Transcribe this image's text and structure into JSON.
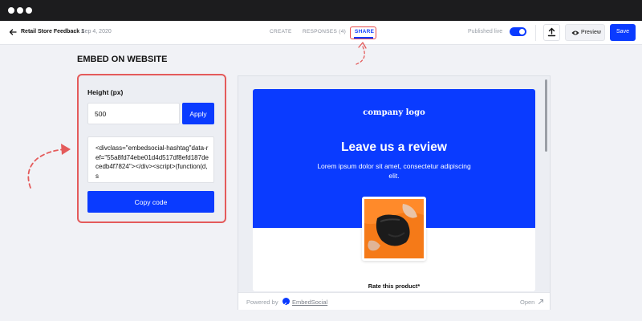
{
  "window": {
    "controls": [
      "dot",
      "dot",
      "dot"
    ]
  },
  "header": {
    "title": "Retail Store Feedback 1",
    "date": "Sep 4, 2020",
    "tabs": [
      {
        "label": "CREATE",
        "active": false
      },
      {
        "label": "RESPONSES (4)",
        "active": false
      },
      {
        "label": "SHARE",
        "active": true
      }
    ],
    "published_label": "Published live",
    "published": true,
    "preview_label": "Preview",
    "save_label": "Save"
  },
  "embed": {
    "heading": "EMBED ON WEBSITE",
    "height_label": "Height (px)",
    "height_value": "500",
    "apply_label": "Apply",
    "code": "<divclass=\"embedsocial-hashtag\"data-ref=\"55a8fd74ebe01d4d517df8efd187decedb4f7824\"></div><script>(function(d,s",
    "copy_label": "Copy code"
  },
  "preview": {
    "logo_text": "company logo",
    "title": "Leave us a review",
    "description": "Lorem ipsum dolor sit amet, consectetur adipiscing elit.",
    "rate_label": "Rate this product*",
    "powered_by": "Powered by",
    "brand": "EmbedSocial",
    "open_label": "Open"
  },
  "colors": {
    "accent": "#0a3bff",
    "highlight": "#e45b5b",
    "background": "#f1f2f6"
  },
  "icons": [
    "back-arrow-icon",
    "upload-icon",
    "eye-icon",
    "external-link-icon",
    "embedsocial-logo-icon"
  ]
}
